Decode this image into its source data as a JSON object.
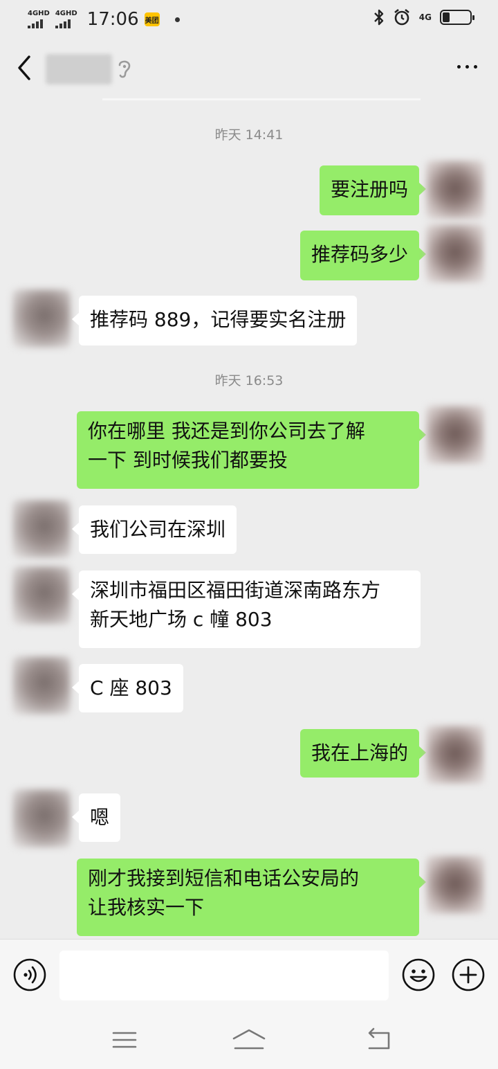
{
  "status_bar": {
    "signal1": "4GHD",
    "signal2": "4GHD",
    "time": "17:06",
    "app_badge": "美团",
    "network": "4G",
    "icons": [
      "bluetooth-icon",
      "alarm-icon",
      "battery-icon"
    ]
  },
  "nav": {
    "title": "",
    "icons": [
      "back-arrow-icon",
      "earpiece-icon",
      "more-icon"
    ]
  },
  "chat": {
    "timestamp_1": "昨天 14:41",
    "timestamp_2": "昨天 16:53",
    "messages": [
      {
        "side": "out",
        "text": "要注册吗"
      },
      {
        "side": "out",
        "text": "推荐码多少"
      },
      {
        "side": "in",
        "text": "推荐码 889，记得要实名注册"
      },
      {
        "side": "out",
        "line1": "你在哪里  我还是到你公司去了解",
        "line2": "一下  到时候我们都要投"
      },
      {
        "side": "in",
        "text": "我们公司在深圳"
      },
      {
        "side": "in",
        "line1": "深圳市福田区福田街道深南路东方",
        "line2": "新天地广场 c 幢 803"
      },
      {
        "side": "in",
        "text": "C 座 803"
      },
      {
        "side": "out",
        "text": "我在上海的"
      },
      {
        "side": "in",
        "text": "嗯"
      },
      {
        "side": "out",
        "line1": "刚才我接到短信和电话公安局的",
        "line2": "让我核实一下"
      }
    ]
  },
  "input_bar": {
    "placeholder": "",
    "icons": [
      "voice-icon",
      "emoji-icon",
      "plus-icon"
    ]
  },
  "system_nav": {
    "icons": [
      "menu-icon",
      "home-icon",
      "back-icon"
    ]
  },
  "colors": {
    "background": "#ededed",
    "outgoing_bubble": "#95ec69",
    "incoming_bubble": "#ffffff",
    "timestamp": "#8a8a8a"
  }
}
